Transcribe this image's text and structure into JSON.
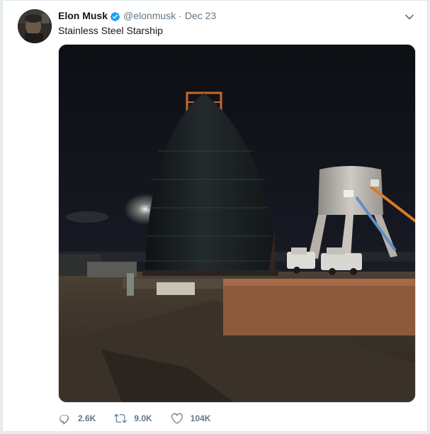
{
  "tweet": {
    "author_name": "Elon Musk",
    "handle": "@elonmusk",
    "separator": "·",
    "date": "Dec 23",
    "text": "Stainless Steel Starship",
    "verified": true,
    "accent_color": "#1da1f2",
    "avatar_icon": "avatar-photo",
    "menu_icon": "chevron-down-icon",
    "media": {
      "icon": "photo",
      "alt": ""
    }
  },
  "actions": {
    "reply": {
      "icon": "reply-icon",
      "count": "2.6K"
    },
    "retweet": {
      "icon": "retweet-icon",
      "count": "9.0K"
    },
    "like": {
      "icon": "heart-icon",
      "count": "104K"
    }
  }
}
